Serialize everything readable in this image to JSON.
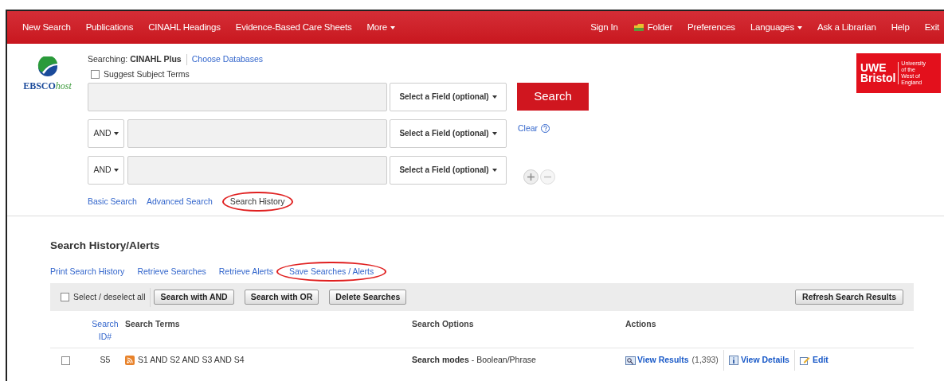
{
  "nav": {
    "left": [
      {
        "label": "New Search",
        "dropdown": false
      },
      {
        "label": "Publications",
        "dropdown": false
      },
      {
        "label": "CINAHL Headings",
        "dropdown": false
      },
      {
        "label": "Evidence-Based Care Sheets",
        "dropdown": false
      },
      {
        "label": "More",
        "dropdown": true
      }
    ],
    "right": [
      {
        "label": "Sign In",
        "dropdown": false
      },
      {
        "label": "Folder",
        "dropdown": false,
        "kind": "folder"
      },
      {
        "label": "Preferences",
        "dropdown": false
      },
      {
        "label": "Languages",
        "dropdown": true
      },
      {
        "label": "Ask a Librarian",
        "dropdown": false
      },
      {
        "label": "Help",
        "dropdown": false
      },
      {
        "label": "Exit",
        "dropdown": false
      }
    ]
  },
  "logo": {
    "text_bold": "EBSCO",
    "text_light": "host"
  },
  "institution_logo": {
    "line1": "UWE",
    "line2": "Bristol",
    "tagline": [
      "University",
      "of the",
      "West of",
      "England"
    ]
  },
  "searching": {
    "label": "Searching:",
    "database": "CINAHL Plus",
    "link": "Choose Databases"
  },
  "suggest_subject_terms": {
    "label": "Suggest Subject Terms",
    "checked": false
  },
  "search_rows": [
    {
      "operator": null,
      "field": "Select a Field (optional)"
    },
    {
      "operator": "AND",
      "field": "Select a Field (optional)"
    },
    {
      "operator": "AND",
      "field": "Select a Field (optional)"
    }
  ],
  "search_button": "Search",
  "clear_link": "Clear",
  "mode_links": [
    {
      "label": "Basic Search",
      "selected": false,
      "circled": false
    },
    {
      "label": "Advanced Search",
      "selected": false,
      "circled": false
    },
    {
      "label": "Search History",
      "selected": true,
      "circled": true
    }
  ],
  "history": {
    "title": "Search History/Alerts",
    "links": [
      {
        "label": "Print Search History",
        "circled": false
      },
      {
        "label": "Retrieve Searches",
        "circled": false
      },
      {
        "label": "Retrieve Alerts",
        "circled": false
      },
      {
        "label": "Save Searches / Alerts",
        "circled": true
      }
    ],
    "select_all": {
      "label": "Select / deselect all",
      "checked": false
    },
    "buttons": [
      "Search with AND",
      "Search with OR",
      "Delete Searches"
    ],
    "refresh_button": "Refresh Search Results",
    "columns": [
      "Search ID#",
      "Search Terms",
      "Search Options",
      "Actions"
    ],
    "rows": [
      {
        "checked": false,
        "id": "S5",
        "terms": "S1 AND S2 AND S3 AND S4",
        "options_label": "Search modes",
        "options_value": "- Boolean/Phrase",
        "view_results": "View Results",
        "count": "(1,393)",
        "view_details": "View Details",
        "edit": "Edit"
      }
    ]
  }
}
